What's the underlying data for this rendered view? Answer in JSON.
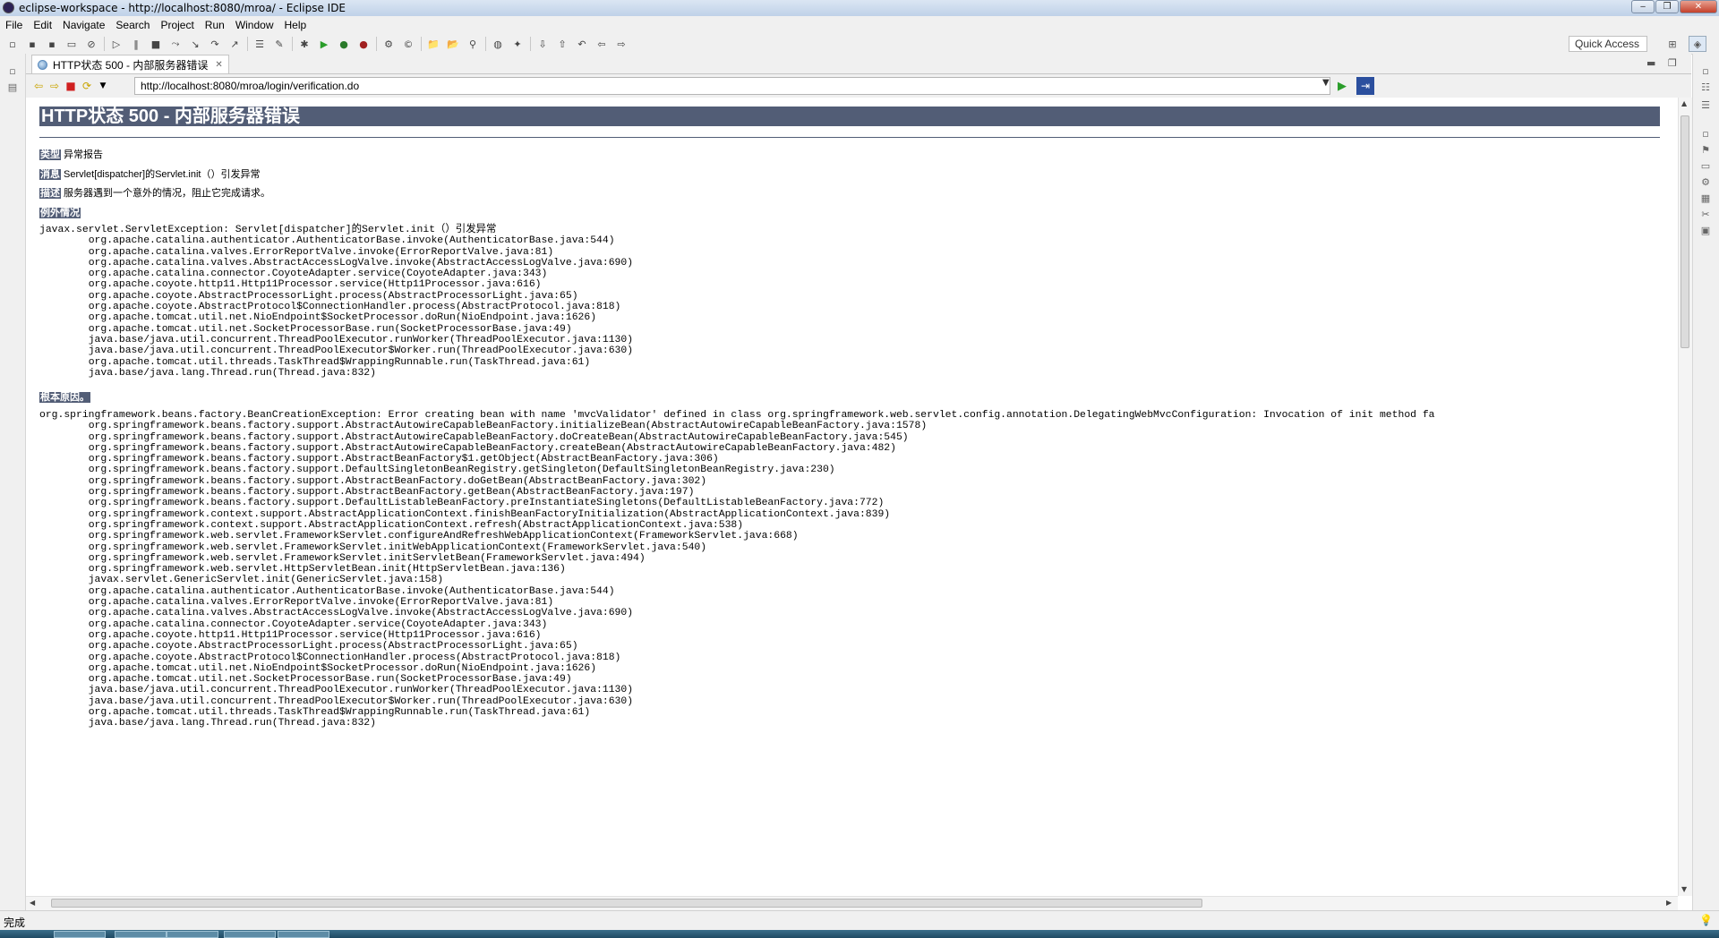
{
  "window": {
    "title": "eclipse-workspace - http://localhost:8080/mroa/ - Eclipse IDE",
    "minimize": "‒",
    "restore": "❐",
    "close": "✕"
  },
  "menu": {
    "file": "File",
    "edit": "Edit",
    "navigate": "Navigate",
    "search": "Search",
    "project": "Project",
    "run": "Run",
    "window": "Window",
    "help": "Help"
  },
  "toolbar": {
    "quick_access": "Quick Access"
  },
  "editor_tab": {
    "label": "HTTP状态 500 - 内部服务器错误",
    "close": "✕"
  },
  "address_bar": {
    "url": "http://localhost:8080/mroa/login/verification.do"
  },
  "page": {
    "heading": "HTTP状态 500 - 内部服务器错误",
    "type_label": "类型",
    "type_value": "异常报告",
    "message_label": "消息",
    "message_value": "Servlet[dispatcher]的Servlet.init（）引发异常",
    "description_label": "描述",
    "description_value": "服务器遇到一个意外的情况，阻止它完成请求。",
    "exception_label": "例外情况",
    "exception_trace": "javax.servlet.ServletException: Servlet[dispatcher]的Servlet.init（）引发异常\n\torg.apache.catalina.authenticator.AuthenticatorBase.invoke(AuthenticatorBase.java:544)\n\torg.apache.catalina.valves.ErrorReportValve.invoke(ErrorReportValve.java:81)\n\torg.apache.catalina.valves.AbstractAccessLogValve.invoke(AbstractAccessLogValve.java:690)\n\torg.apache.catalina.connector.CoyoteAdapter.service(CoyoteAdapter.java:343)\n\torg.apache.coyote.http11.Http11Processor.service(Http11Processor.java:616)\n\torg.apache.coyote.AbstractProcessorLight.process(AbstractProcessorLight.java:65)\n\torg.apache.coyote.AbstractProtocol$ConnectionHandler.process(AbstractProtocol.java:818)\n\torg.apache.tomcat.util.net.NioEndpoint$SocketProcessor.doRun(NioEndpoint.java:1626)\n\torg.apache.tomcat.util.net.SocketProcessorBase.run(SocketProcessorBase.java:49)\n\tjava.base/java.util.concurrent.ThreadPoolExecutor.runWorker(ThreadPoolExecutor.java:1130)\n\tjava.base/java.util.concurrent.ThreadPoolExecutor$Worker.run(ThreadPoolExecutor.java:630)\n\torg.apache.tomcat.util.threads.TaskThread$WrappingRunnable.run(TaskThread.java:61)\n\tjava.base/java.lang.Thread.run(Thread.java:832)",
    "root_cause_label": "根本原因。",
    "root_cause_trace": "org.springframework.beans.factory.BeanCreationException: Error creating bean with name 'mvcValidator' defined in class org.springframework.web.servlet.config.annotation.DelegatingWebMvcConfiguration: Invocation of init method fa\n\torg.springframework.beans.factory.support.AbstractAutowireCapableBeanFactory.initializeBean(AbstractAutowireCapableBeanFactory.java:1578)\n\torg.springframework.beans.factory.support.AbstractAutowireCapableBeanFactory.doCreateBean(AbstractAutowireCapableBeanFactory.java:545)\n\torg.springframework.beans.factory.support.AbstractAutowireCapableBeanFactory.createBean(AbstractAutowireCapableBeanFactory.java:482)\n\torg.springframework.beans.factory.support.AbstractBeanFactory$1.getObject(AbstractBeanFactory.java:306)\n\torg.springframework.beans.factory.support.DefaultSingletonBeanRegistry.getSingleton(DefaultSingletonBeanRegistry.java:230)\n\torg.springframework.beans.factory.support.AbstractBeanFactory.doGetBean(AbstractBeanFactory.java:302)\n\torg.springframework.beans.factory.support.AbstractBeanFactory.getBean(AbstractBeanFactory.java:197)\n\torg.springframework.beans.factory.support.DefaultListableBeanFactory.preInstantiateSingletons(DefaultListableBeanFactory.java:772)\n\torg.springframework.context.support.AbstractApplicationContext.finishBeanFactoryInitialization(AbstractApplicationContext.java:839)\n\torg.springframework.context.support.AbstractApplicationContext.refresh(AbstractApplicationContext.java:538)\n\torg.springframework.web.servlet.FrameworkServlet.configureAndRefreshWebApplicationContext(FrameworkServlet.java:668)\n\torg.springframework.web.servlet.FrameworkServlet.initWebApplicationContext(FrameworkServlet.java:540)\n\torg.springframework.web.servlet.FrameworkServlet.initServletBean(FrameworkServlet.java:494)\n\torg.springframework.web.servlet.HttpServletBean.init(HttpServletBean.java:136)\n\tjavax.servlet.GenericServlet.init(GenericServlet.java:158)\n\torg.apache.catalina.authenticator.AuthenticatorBase.invoke(AuthenticatorBase.java:544)\n\torg.apache.catalina.valves.ErrorReportValve.invoke(ErrorReportValve.java:81)\n\torg.apache.catalina.valves.AbstractAccessLogValve.invoke(AbstractAccessLogValve.java:690)\n\torg.apache.catalina.connector.CoyoteAdapter.service(CoyoteAdapter.java:343)\n\torg.apache.coyote.http11.Http11Processor.service(Http11Processor.java:616)\n\torg.apache.coyote.AbstractProcessorLight.process(AbstractProcessorLight.java:65)\n\torg.apache.coyote.AbstractProtocol$ConnectionHandler.process(AbstractProtocol.java:818)\n\torg.apache.tomcat.util.net.NioEndpoint$SocketProcessor.doRun(NioEndpoint.java:1626)\n\torg.apache.tomcat.util.net.SocketProcessorBase.run(SocketProcessorBase.java:49)\n\tjava.base/java.util.concurrent.ThreadPoolExecutor.runWorker(ThreadPoolExecutor.java:1130)\n\tjava.base/java.util.concurrent.ThreadPoolExecutor$Worker.run(ThreadPoolExecutor.java:630)\n\torg.apache.tomcat.util.threads.TaskThread$WrappingRunnable.run(TaskThread.java:61)\n\tjava.base/java.lang.Thread.run(Thread.java:832)"
  },
  "status": {
    "text": "完成"
  },
  "colors": {
    "error_header_bg": "#525d76",
    "chrome_bg": "#f0f0f0"
  }
}
